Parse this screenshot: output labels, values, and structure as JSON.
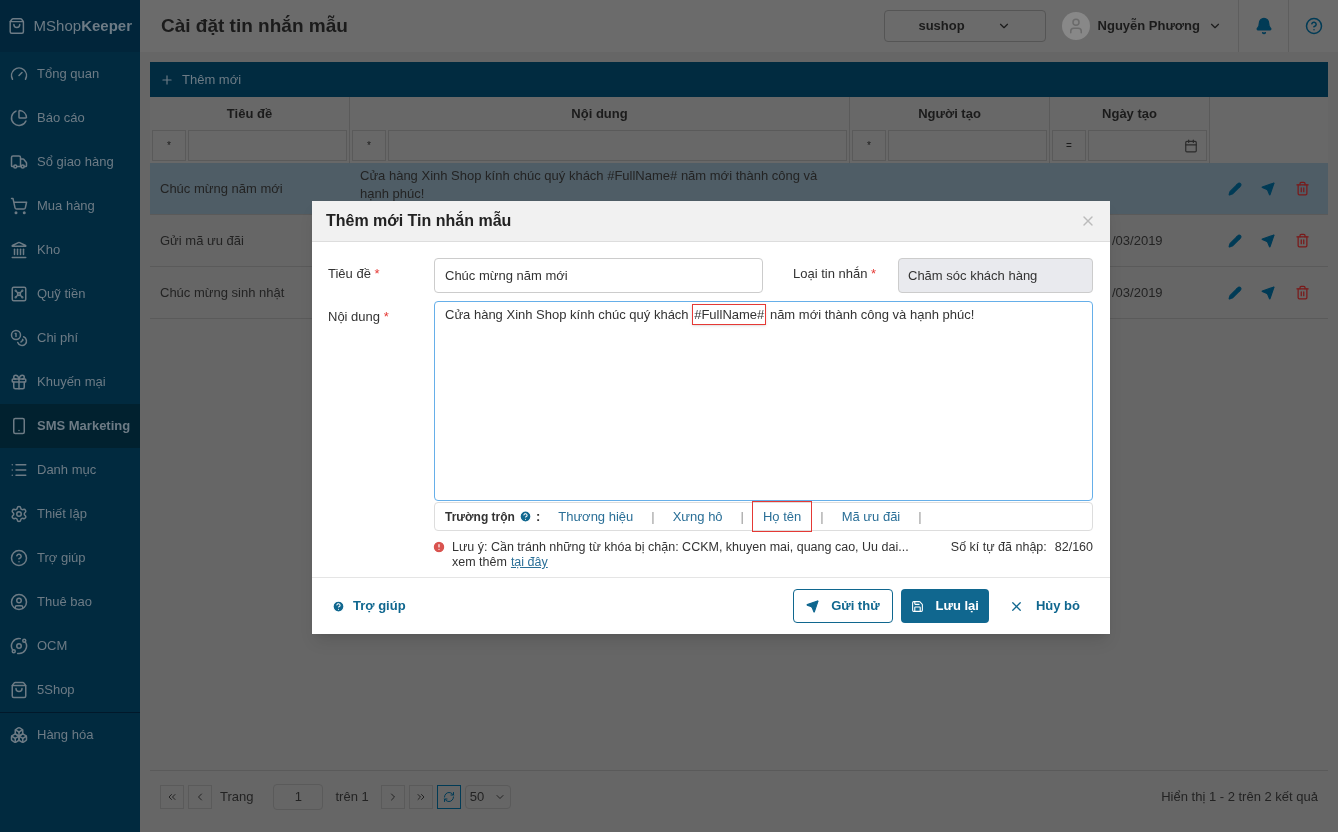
{
  "logo": "MShop**Keeper**",
  "sidebar": {
    "items": [
      {
        "label": "Tổng quan",
        "selected": false
      },
      {
        "label": "Báo cáo",
        "selected": false
      },
      {
        "label": "Sổ giao hàng",
        "selected": false
      },
      {
        "label": "Mua hàng",
        "selected": false
      },
      {
        "label": "Kho",
        "selected": false
      },
      {
        "label": "Quỹ tiền",
        "selected": false
      },
      {
        "label": "Chi phí",
        "selected": false
      },
      {
        "label": "Khuyến mại",
        "selected": false
      },
      {
        "label": "SMS Marketing",
        "selected": true
      },
      {
        "label": "Danh mục",
        "selected": false
      },
      {
        "label": "Thiết lập",
        "selected": false
      },
      {
        "label": "Trợ giúp",
        "selected": false
      },
      {
        "label": "Thuê bao",
        "selected": false
      },
      {
        "label": "OCM",
        "selected": false
      },
      {
        "label": "5Shop",
        "selected": false
      },
      {
        "label": "Hàng hóa",
        "selected": false
      }
    ]
  },
  "header": {
    "title": "Cài đặt tin nhắn mẫu",
    "store": "sushop",
    "user": "Nguyễn Phương"
  },
  "toolbar": {
    "add_button": "Thêm mới"
  },
  "table": {
    "columns": [
      {
        "label": "Tiêu đề",
        "operator": "*"
      },
      {
        "label": "Nội dung",
        "operator": "*"
      },
      {
        "label": "Người tạo",
        "operator": "*"
      },
      {
        "label": "Ngày tạo",
        "operator": "="
      }
    ],
    "rows": [
      {
        "title": "Chúc mừng năm mới",
        "content": "Cửa hàng Xinh Shop kính chúc quý khách #FullName# năm mới thành công và",
        "content_line2": "hạnh phúc!",
        "date": "",
        "selected": true
      },
      {
        "title": "Gửi mã ưu đãi",
        "content": "",
        "date": "/03/2019",
        "selected": false
      },
      {
        "title": "Chúc mừng sinh nhật",
        "content": "",
        "date": "/03/2019",
        "selected": false
      }
    ]
  },
  "pagination": {
    "page_label": "Trang",
    "page": "1",
    "of_label": "trên 1",
    "page_size": "50",
    "summary": "Hiển thị 1 - 2 trên 2 kết quả"
  },
  "dialog": {
    "title": "Thêm mới Tin nhắn mẫu",
    "title_label": "Tiêu đề",
    "title_value": "Chúc mừng năm mới",
    "type_label": "Loại tin nhắn",
    "type_value": "Chăm sóc khách hàng",
    "content_label": "Nội dung",
    "content_before": "Cửa hàng Xinh Shop kính chúc quý khách ",
    "content_token": "#FullName#",
    "content_after": " năm mới thành công và hạnh phúc!",
    "merge_label": "Trường trộn",
    "merge_colon": ":",
    "merge_fields": [
      {
        "label": "Thương hiệu",
        "separator": "|",
        "selected": false
      },
      {
        "label": "Xưng hô",
        "separator": "|",
        "selected": false
      },
      {
        "label": "Họ tên",
        "separator": "|",
        "selected": true
      },
      {
        "label": "Mã ưu đãi",
        "separator": "|",
        "selected": false
      }
    ],
    "note": "Lưu ý: Cần tránh những từ khóa bị chặn: CCKM, khuyen mai, quang cao, Uu dai...",
    "more_text": "xem thêm",
    "more_link": "tại đây",
    "counter_label": "Số kí tự đã nhập:",
    "counter_value": "82/160",
    "help": "Trợ giúp",
    "send_test": "Gửi thử",
    "save": "Lưu lại",
    "cancel": "Hủy bỏ"
  }
}
